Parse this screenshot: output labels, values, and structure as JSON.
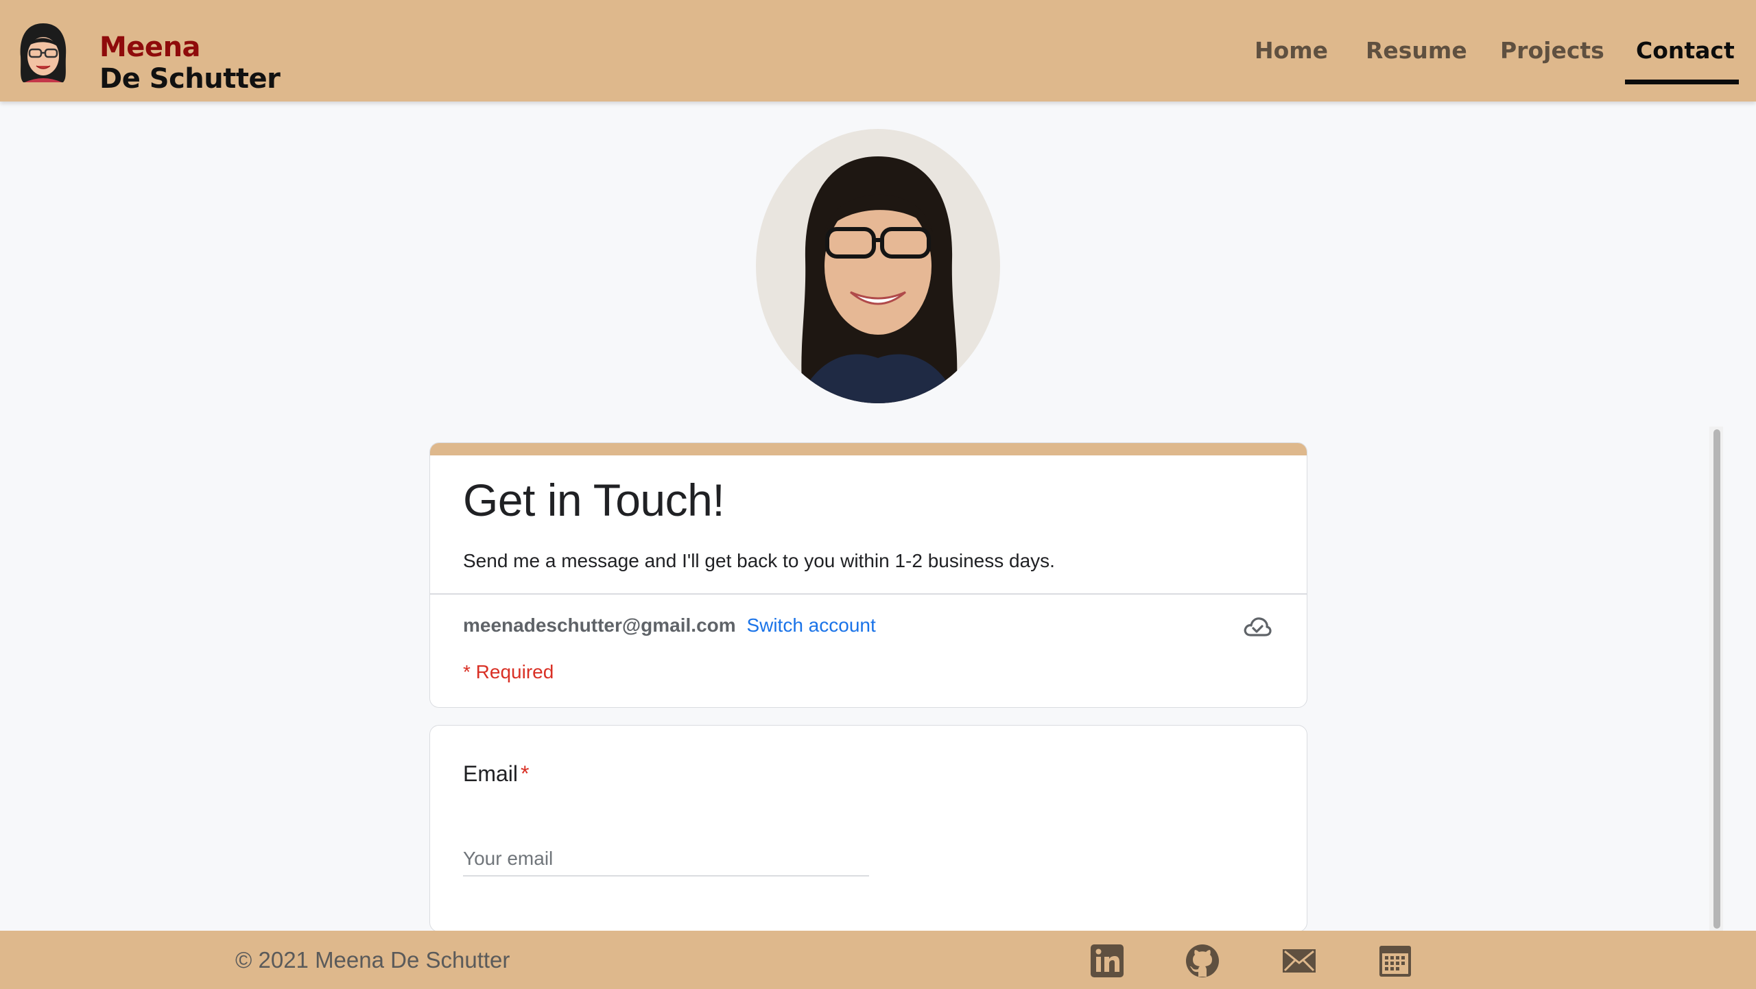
{
  "brand": {
    "first_name": "Meena",
    "last_name": "De Schutter"
  },
  "nav": {
    "items": [
      {
        "label": "Home"
      },
      {
        "label": "Resume"
      },
      {
        "label": "Projects"
      },
      {
        "label": "Contact"
      }
    ],
    "active": "Contact"
  },
  "form": {
    "title": "Get in Touch!",
    "description": "Send me a message and I'll get back to you within 1-2 business days.",
    "account_email": "meenadeschutter@gmail.com",
    "switch_account": "Switch account",
    "required_note": "* Required",
    "question": {
      "label": "Email",
      "required_mark": "*",
      "placeholder": "Your email"
    }
  },
  "footer": {
    "copyright": "© 2021 Meena De Schutter",
    "icons": [
      "linkedin-icon",
      "github-icon",
      "email-icon",
      "calendar-icon"
    ]
  },
  "colors": {
    "header_bg": "#deb88c",
    "brand_red": "#8f0b0b",
    "link_blue": "#1a73e8",
    "required_red": "#d93025",
    "page_bg": "#f7f8fa",
    "icon_brown": "#5f5040"
  }
}
